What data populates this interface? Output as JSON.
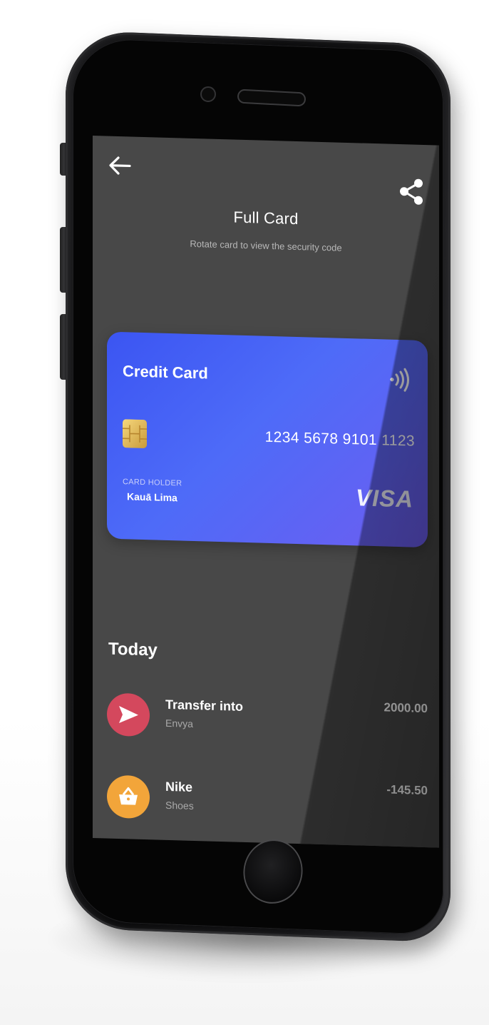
{
  "screen": {
    "title": "Full Card",
    "subtitle": "Rotate card to view the security code"
  },
  "header": {
    "back_icon": "arrow-left-icon",
    "share_icon": "share-icon"
  },
  "card": {
    "type_label": "Credit Card",
    "number": "1234 5678 9101 1123",
    "holder_label": "CARD HOLDER",
    "holder_name": "Kauā Lima",
    "brand": "VISA",
    "contactless_icon": "contactless-icon",
    "chip_icon": "chip-icon",
    "colors": {
      "gradient_start": "#3b55f2",
      "gradient_end": "#6d5df0"
    }
  },
  "activity": {
    "section_title": "Today",
    "transactions": [
      {
        "title": "Transfer into",
        "subtitle": "Envya",
        "amount": "2000.00",
        "icon": "send-icon",
        "color": "#d4485d"
      },
      {
        "title": "Nike",
        "subtitle": "Shoes",
        "amount": "-145.50",
        "icon": "basket-icon",
        "color": "#f2a53a"
      }
    ]
  },
  "colors": {
    "screen_background": "#484848",
    "text_primary": "#ffffff",
    "text_secondary": "#b8b8b8"
  }
}
